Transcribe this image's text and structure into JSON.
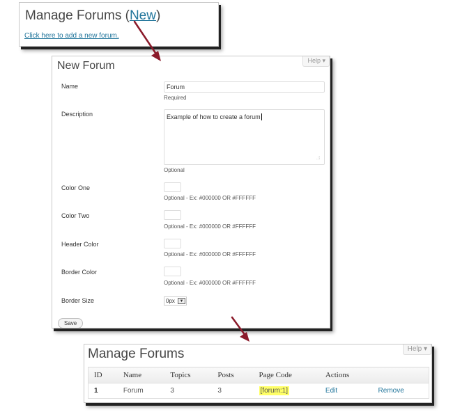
{
  "panel_list_top": {
    "title_prefix": "Manage Forums (",
    "title_link": "New",
    "title_suffix": ")",
    "add_link": "Click here to add a new forum."
  },
  "new_forum": {
    "title": "New Forum",
    "help_tab": "Help ▾",
    "fields": {
      "name": {
        "label": "Name",
        "value": "Forum",
        "note": "Required"
      },
      "description": {
        "label": "Description",
        "value": "Example of how to create a forum",
        "note": "Optional"
      },
      "color_one": {
        "label": "Color One",
        "note": "Optional - Ex: #000000 OR #FFFFFF"
      },
      "color_two": {
        "label": "Color Two",
        "note": "Optional - Ex: #000000 OR #FFFFFF"
      },
      "header_color": {
        "label": "Header Color",
        "note": "Optional - Ex: #000000 OR #FFFFFF"
      },
      "border_color": {
        "label": "Border Color",
        "note": "Optional - Ex: #000000 OR #FFFFFF"
      },
      "border_size": {
        "label": "Border Size",
        "value": "0px"
      }
    },
    "save_label": "Save"
  },
  "manage_forums": {
    "title": "Manage Forums",
    "help_tab": "Help ▾",
    "columns": [
      "ID",
      "Name",
      "Topics",
      "Posts",
      "Page Code",
      "Actions"
    ],
    "rows": [
      {
        "id": "1",
        "name": "Forum",
        "topics": "3",
        "posts": "3",
        "page_code": "[forum:1]",
        "edit": "Edit",
        "remove": "Remove"
      }
    ]
  },
  "colors": {
    "link": "#21759b",
    "arrow": "#8b1a2a",
    "highlight": "#ffff66"
  }
}
